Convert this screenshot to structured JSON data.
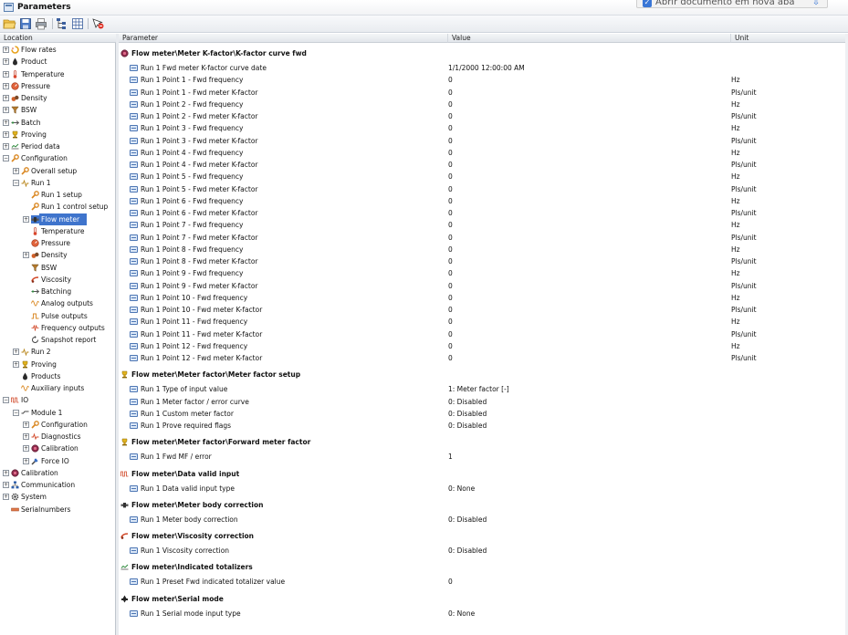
{
  "window": {
    "title": "Parameters"
  },
  "browser_overlay": {
    "checkbox_label": "Abrir documento em nova aba"
  },
  "toolbar": {
    "buttons": [
      "open-icon",
      "save-icon",
      "print-icon",
      "tree-view-icon",
      "grid-view-icon",
      "undo-icon"
    ]
  },
  "columns": {
    "location": "Location",
    "parameter": "Parameter",
    "value": "Value",
    "unit": "Unit"
  },
  "tree": [
    {
      "label": "Flow rates",
      "level": 0,
      "expander": "+",
      "icon": "flow-rates-icon"
    },
    {
      "label": "Product",
      "level": 0,
      "expander": "+",
      "icon": "product-drop-icon"
    },
    {
      "label": "Temperature",
      "level": 0,
      "expander": "+",
      "icon": "thermometer-icon"
    },
    {
      "label": "Pressure",
      "level": 0,
      "expander": "+",
      "icon": "pressure-gauge-icon"
    },
    {
      "label": "Density",
      "level": 0,
      "expander": "+",
      "icon": "density-icon"
    },
    {
      "label": "BSW",
      "level": 0,
      "expander": "+",
      "icon": "funnel-icon"
    },
    {
      "label": "Batch",
      "level": 0,
      "expander": "+",
      "icon": "batch-icon"
    },
    {
      "label": "Proving",
      "level": 0,
      "expander": "+",
      "icon": "prover-icon"
    },
    {
      "label": "Period data",
      "level": 0,
      "expander": "+",
      "icon": "period-data-icon"
    },
    {
      "label": "Configuration",
      "level": 0,
      "expander": "−",
      "icon": "configuration-icon"
    },
    {
      "label": "Overall setup",
      "level": 1,
      "expander": "+",
      "icon": "configuration-icon"
    },
    {
      "label": "Run 1",
      "level": 1,
      "expander": "−",
      "icon": "run-icon"
    },
    {
      "label": "Run 1 setup",
      "level": 2,
      "expander": "",
      "icon": "configuration-icon"
    },
    {
      "label": "Run 1 control setup",
      "level": 2,
      "expander": "",
      "icon": "configuration-icon"
    },
    {
      "label": "Flow meter",
      "level": 2,
      "expander": "+",
      "icon": "flow-meter-icon",
      "selected": true
    },
    {
      "label": "Temperature",
      "level": 2,
      "expander": "",
      "icon": "thermometer-icon"
    },
    {
      "label": "Pressure",
      "level": 2,
      "expander": "",
      "icon": "pressure-gauge-icon"
    },
    {
      "label": "Density",
      "level": 2,
      "expander": "+",
      "icon": "density-icon"
    },
    {
      "label": "BSW",
      "level": 2,
      "expander": "",
      "icon": "funnel-icon"
    },
    {
      "label": "Viscosity",
      "level": 2,
      "expander": "",
      "icon": "viscosity-icon"
    },
    {
      "label": "Batching",
      "level": 2,
      "expander": "",
      "icon": "batch-icon"
    },
    {
      "label": "Analog outputs",
      "level": 2,
      "expander": "",
      "icon": "analog-wave-icon"
    },
    {
      "label": "Pulse outputs",
      "level": 2,
      "expander": "",
      "icon": "pulse-icon"
    },
    {
      "label": "Frequency outputs",
      "level": 2,
      "expander": "",
      "icon": "frequency-icon"
    },
    {
      "label": "Snapshot report",
      "level": 2,
      "expander": "",
      "icon": "snapshot-icon"
    },
    {
      "label": "Run 2",
      "level": 1,
      "expander": "+",
      "icon": "run-icon"
    },
    {
      "label": "Proving",
      "level": 1,
      "expander": "+",
      "icon": "prover-icon"
    },
    {
      "label": "Products",
      "level": 1,
      "expander": "",
      "icon": "product-drop-icon"
    },
    {
      "label": "Auxiliary inputs",
      "level": 1,
      "expander": "",
      "icon": "analog-wave-icon"
    },
    {
      "label": "IO",
      "level": 0,
      "expander": "−",
      "icon": "io-icon"
    },
    {
      "label": "Module 1",
      "level": 1,
      "expander": "−",
      "icon": "module-icon"
    },
    {
      "label": "Configuration",
      "level": 2,
      "expander": "+",
      "icon": "configuration-icon"
    },
    {
      "label": "Diagnostics",
      "level": 2,
      "expander": "+",
      "icon": "diagnostics-icon"
    },
    {
      "label": "Calibration",
      "level": 2,
      "expander": "+",
      "icon": "calibration-icon"
    },
    {
      "label": "Force IO",
      "level": 2,
      "expander": "+",
      "icon": "wrench-icon"
    },
    {
      "label": "Calibration",
      "level": 0,
      "expander": "+",
      "icon": "calibration-icon"
    },
    {
      "label": "Communication",
      "level": 0,
      "expander": "+",
      "icon": "network-icon"
    },
    {
      "label": "System",
      "level": 0,
      "expander": "+",
      "icon": "system-gear-icon"
    },
    {
      "label": "Serialnumbers",
      "level": 0,
      "expander": "",
      "icon": "serial-icon"
    }
  ],
  "sections": [
    {
      "title": "Flow meter\\Meter K-factor\\K-factor curve fwd",
      "icon": "calibration-icon",
      "rows": [
        {
          "name": "Run 1 Fwd meter K-factor curve date",
          "value": "1/1/2000 12:00:00 AM",
          "unit": ""
        },
        {
          "name": "Run 1 Point 1 - Fwd frequency",
          "value": "0",
          "unit": "Hz"
        },
        {
          "name": "Run 1 Point 1 - Fwd meter K-factor",
          "value": "0",
          "unit": "Pls/unit"
        },
        {
          "name": "Run 1 Point 2 - Fwd frequency",
          "value": "0",
          "unit": "Hz"
        },
        {
          "name": "Run 1 Point 2 - Fwd meter K-factor",
          "value": "0",
          "unit": "Pls/unit"
        },
        {
          "name": "Run 1 Point 3 - Fwd frequency",
          "value": "0",
          "unit": "Hz"
        },
        {
          "name": "Run 1 Point 3 - Fwd meter K-factor",
          "value": "0",
          "unit": "Pls/unit"
        },
        {
          "name": "Run 1 Point 4 - Fwd frequency",
          "value": "0",
          "unit": "Hz"
        },
        {
          "name": "Run 1 Point 4 - Fwd meter K-factor",
          "value": "0",
          "unit": "Pls/unit"
        },
        {
          "name": "Run 1 Point 5 - Fwd frequency",
          "value": "0",
          "unit": "Hz"
        },
        {
          "name": "Run 1 Point 5 - Fwd meter K-factor",
          "value": "0",
          "unit": "Pls/unit"
        },
        {
          "name": "Run 1 Point 6 - Fwd frequency",
          "value": "0",
          "unit": "Hz"
        },
        {
          "name": "Run 1 Point 6 - Fwd meter K-factor",
          "value": "0",
          "unit": "Pls/unit"
        },
        {
          "name": "Run 1 Point 7 - Fwd frequency",
          "value": "0",
          "unit": "Hz"
        },
        {
          "name": "Run 1 Point 7 - Fwd meter K-factor",
          "value": "0",
          "unit": "Pls/unit"
        },
        {
          "name": "Run 1 Point 8 - Fwd frequency",
          "value": "0",
          "unit": "Hz"
        },
        {
          "name": "Run 1 Point 8 - Fwd meter K-factor",
          "value": "0",
          "unit": "Pls/unit"
        },
        {
          "name": "Run 1 Point 9 - Fwd frequency",
          "value": "0",
          "unit": "Hz"
        },
        {
          "name": "Run 1 Point 9 - Fwd meter K-factor",
          "value": "0",
          "unit": "Pls/unit"
        },
        {
          "name": "Run 1 Point 10 - Fwd frequency",
          "value": "0",
          "unit": "Hz"
        },
        {
          "name": "Run 1 Point 10 - Fwd meter K-factor",
          "value": "0",
          "unit": "Pls/unit"
        },
        {
          "name": "Run 1 Point 11 - Fwd frequency",
          "value": "0",
          "unit": "Hz"
        },
        {
          "name": "Run 1 Point 11 - Fwd meter K-factor",
          "value": "0",
          "unit": "Pls/unit"
        },
        {
          "name": "Run 1 Point 12 - Fwd frequency",
          "value": "0",
          "unit": "Hz"
        },
        {
          "name": "Run 1 Point 12 - Fwd meter K-factor",
          "value": "0",
          "unit": "Pls/unit"
        }
      ]
    },
    {
      "title": "Flow meter\\Meter factor\\Meter factor setup",
      "icon": "prover-icon",
      "rows": [
        {
          "name": "Run 1 Type of input value",
          "value": "1: Meter factor [-]",
          "unit": ""
        },
        {
          "name": "Run 1 Meter factor / error curve",
          "value": "0: Disabled",
          "unit": ""
        },
        {
          "name": "Run 1 Custom meter factor",
          "value": "0: Disabled",
          "unit": ""
        },
        {
          "name": "Run 1 Prove required flags",
          "value": "0: Disabled",
          "unit": ""
        }
      ]
    },
    {
      "title": "Flow meter\\Meter factor\\Forward meter factor",
      "icon": "prover-icon",
      "rows": [
        {
          "name": "Run 1 Fwd MF / error",
          "value": "1",
          "unit": ""
        }
      ]
    },
    {
      "title": "Flow meter\\Data valid input",
      "icon": "io-icon",
      "rows": [
        {
          "name": "Run 1 Data valid input type",
          "value": "0: None",
          "unit": ""
        }
      ]
    },
    {
      "title": "Flow meter\\Meter body correction",
      "icon": "flow-meter-icon",
      "rows": [
        {
          "name": "Run 1 Meter body correction",
          "value": "0: Disabled",
          "unit": ""
        }
      ]
    },
    {
      "title": "Flow meter\\Viscosity correction",
      "icon": "viscosity-icon",
      "rows": [
        {
          "name": "Run 1 Viscosity correction",
          "value": "0: Disabled",
          "unit": ""
        }
      ]
    },
    {
      "title": "Flow meter\\Indicated totalizers",
      "icon": "period-data-icon",
      "rows": [
        {
          "name": "Run 1 Preset Fwd indicated totalizer value",
          "value": "0",
          "unit": ""
        }
      ]
    },
    {
      "title": "Flow meter\\Serial mode",
      "icon": "serial-mode-icon",
      "rows": [
        {
          "name": "Run 1 Serial mode input type",
          "value": "0: None",
          "unit": ""
        }
      ]
    }
  ]
}
